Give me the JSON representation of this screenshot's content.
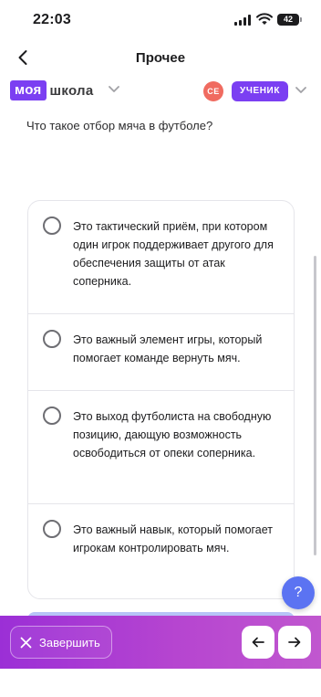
{
  "status_bar": {
    "time": "22:03",
    "battery": "42"
  },
  "nav": {
    "title": "Прочее"
  },
  "header": {
    "logo_highlight": "моя",
    "logo_word": "школа",
    "avatar_initials": "СЕ",
    "role": "УЧЕНИК"
  },
  "question": {
    "text": "Что такое отбор мяча в футболе?"
  },
  "answers": [
    {
      "text": "Это тактический приём, при котором один игрок поддерживает другого для обеспечения защиты от атак соперника.",
      "selected": false
    },
    {
      "text": "Это важный элемент игры, который помогает команде вернуть мяч.",
      "selected": false
    },
    {
      "text": "Это выход футболиста на свободную позицию, дающую возможность освободиться от опеки соперника.",
      "selected": false
    },
    {
      "text": "Это важный навык, который помогает игрокам контролировать мяч.",
      "selected": false
    }
  ],
  "help": {
    "label": "?"
  },
  "bottom_bar": {
    "finish_label": "Завершить"
  },
  "colors": {
    "accent": "#7b3ff2",
    "avatar": "#f06b60",
    "help": "#5b73f2",
    "bar_start": "#9b2fd6",
    "bar_end": "#c057cf"
  }
}
